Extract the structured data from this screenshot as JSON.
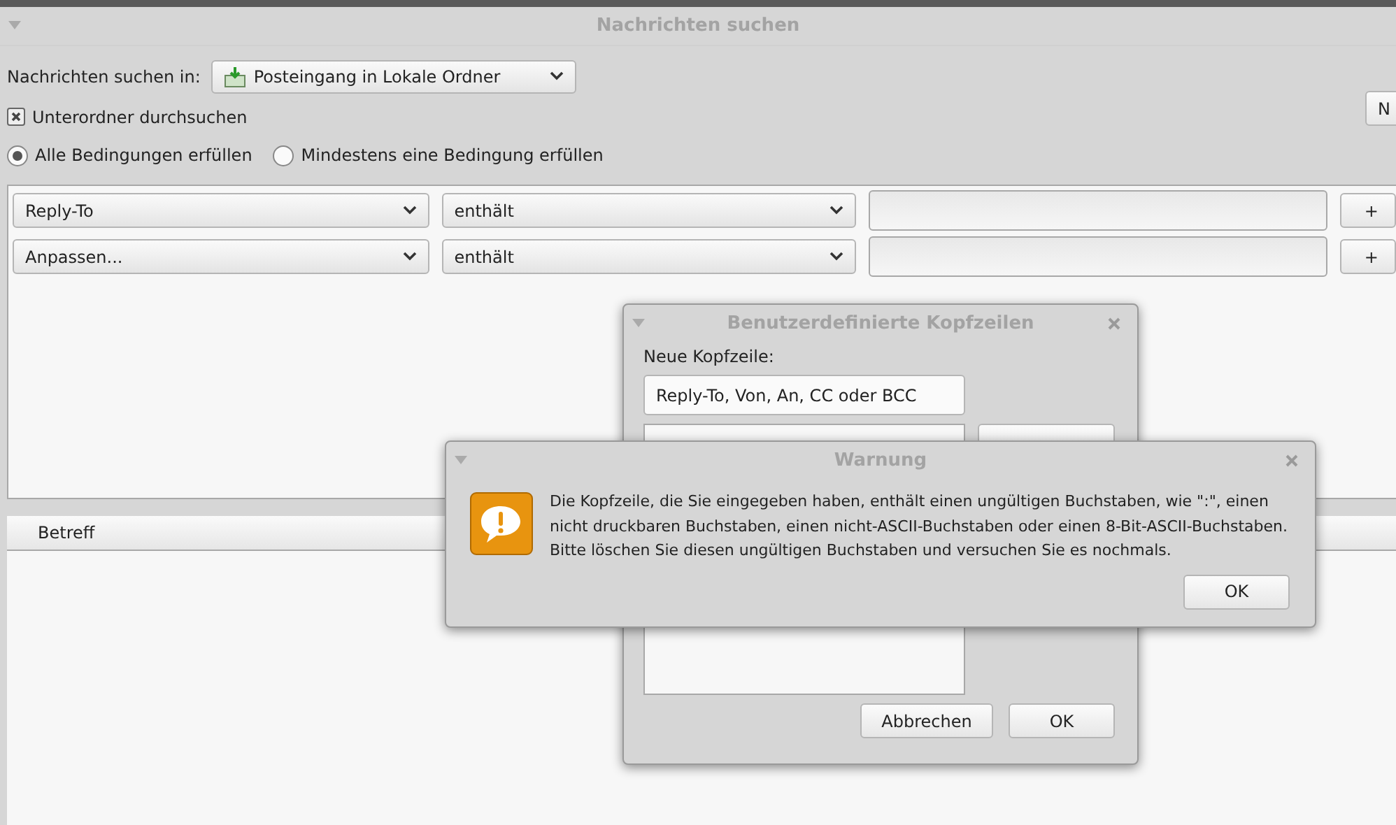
{
  "window": {
    "title": "Nachrichten suchen"
  },
  "search_in": {
    "label": "Nachrichten suchen in:",
    "folder": "Posteingang in Lokale Ordner"
  },
  "subfolders": {
    "label": "Unterordner durchsuchen",
    "checked": true
  },
  "match": [
    {
      "label": "Alle Bedingungen erfüllen",
      "selected": true
    },
    {
      "label": "Mindestens eine Bedingung erfüllen",
      "selected": false
    }
  ],
  "side_button": {
    "label": "N"
  },
  "criteria": [
    {
      "field": "Reply-To",
      "operator": "enthält",
      "add": "+"
    },
    {
      "field": "Anpassen...",
      "operator": "enthält",
      "add": "+"
    }
  ],
  "results": {
    "columns": [
      "Betreff"
    ]
  },
  "custom_headers_dialog": {
    "title": "Benutzerdefinierte Kopfzeilen",
    "label": "Neue Kopfzeile:",
    "placeholder": "Reply-To, Von, An, CC oder BCC",
    "buttons": [
      "Abbrechen",
      "OK"
    ]
  },
  "warning_dialog": {
    "title": "Warnung",
    "message": "Die Kopfzeile, die Sie eingegeben haben, enthält einen ungültigen Buchstaben, wie \":\", einen nicht druckbaren Buchstaben, einen nicht-ASCII-Buchstaben oder einen 8-Bit-ASCII-Buchstaben. Bitte löschen Sie diesen ungültigen Buchstaben und versuchen Sie es nochmals.",
    "button": "OK"
  }
}
